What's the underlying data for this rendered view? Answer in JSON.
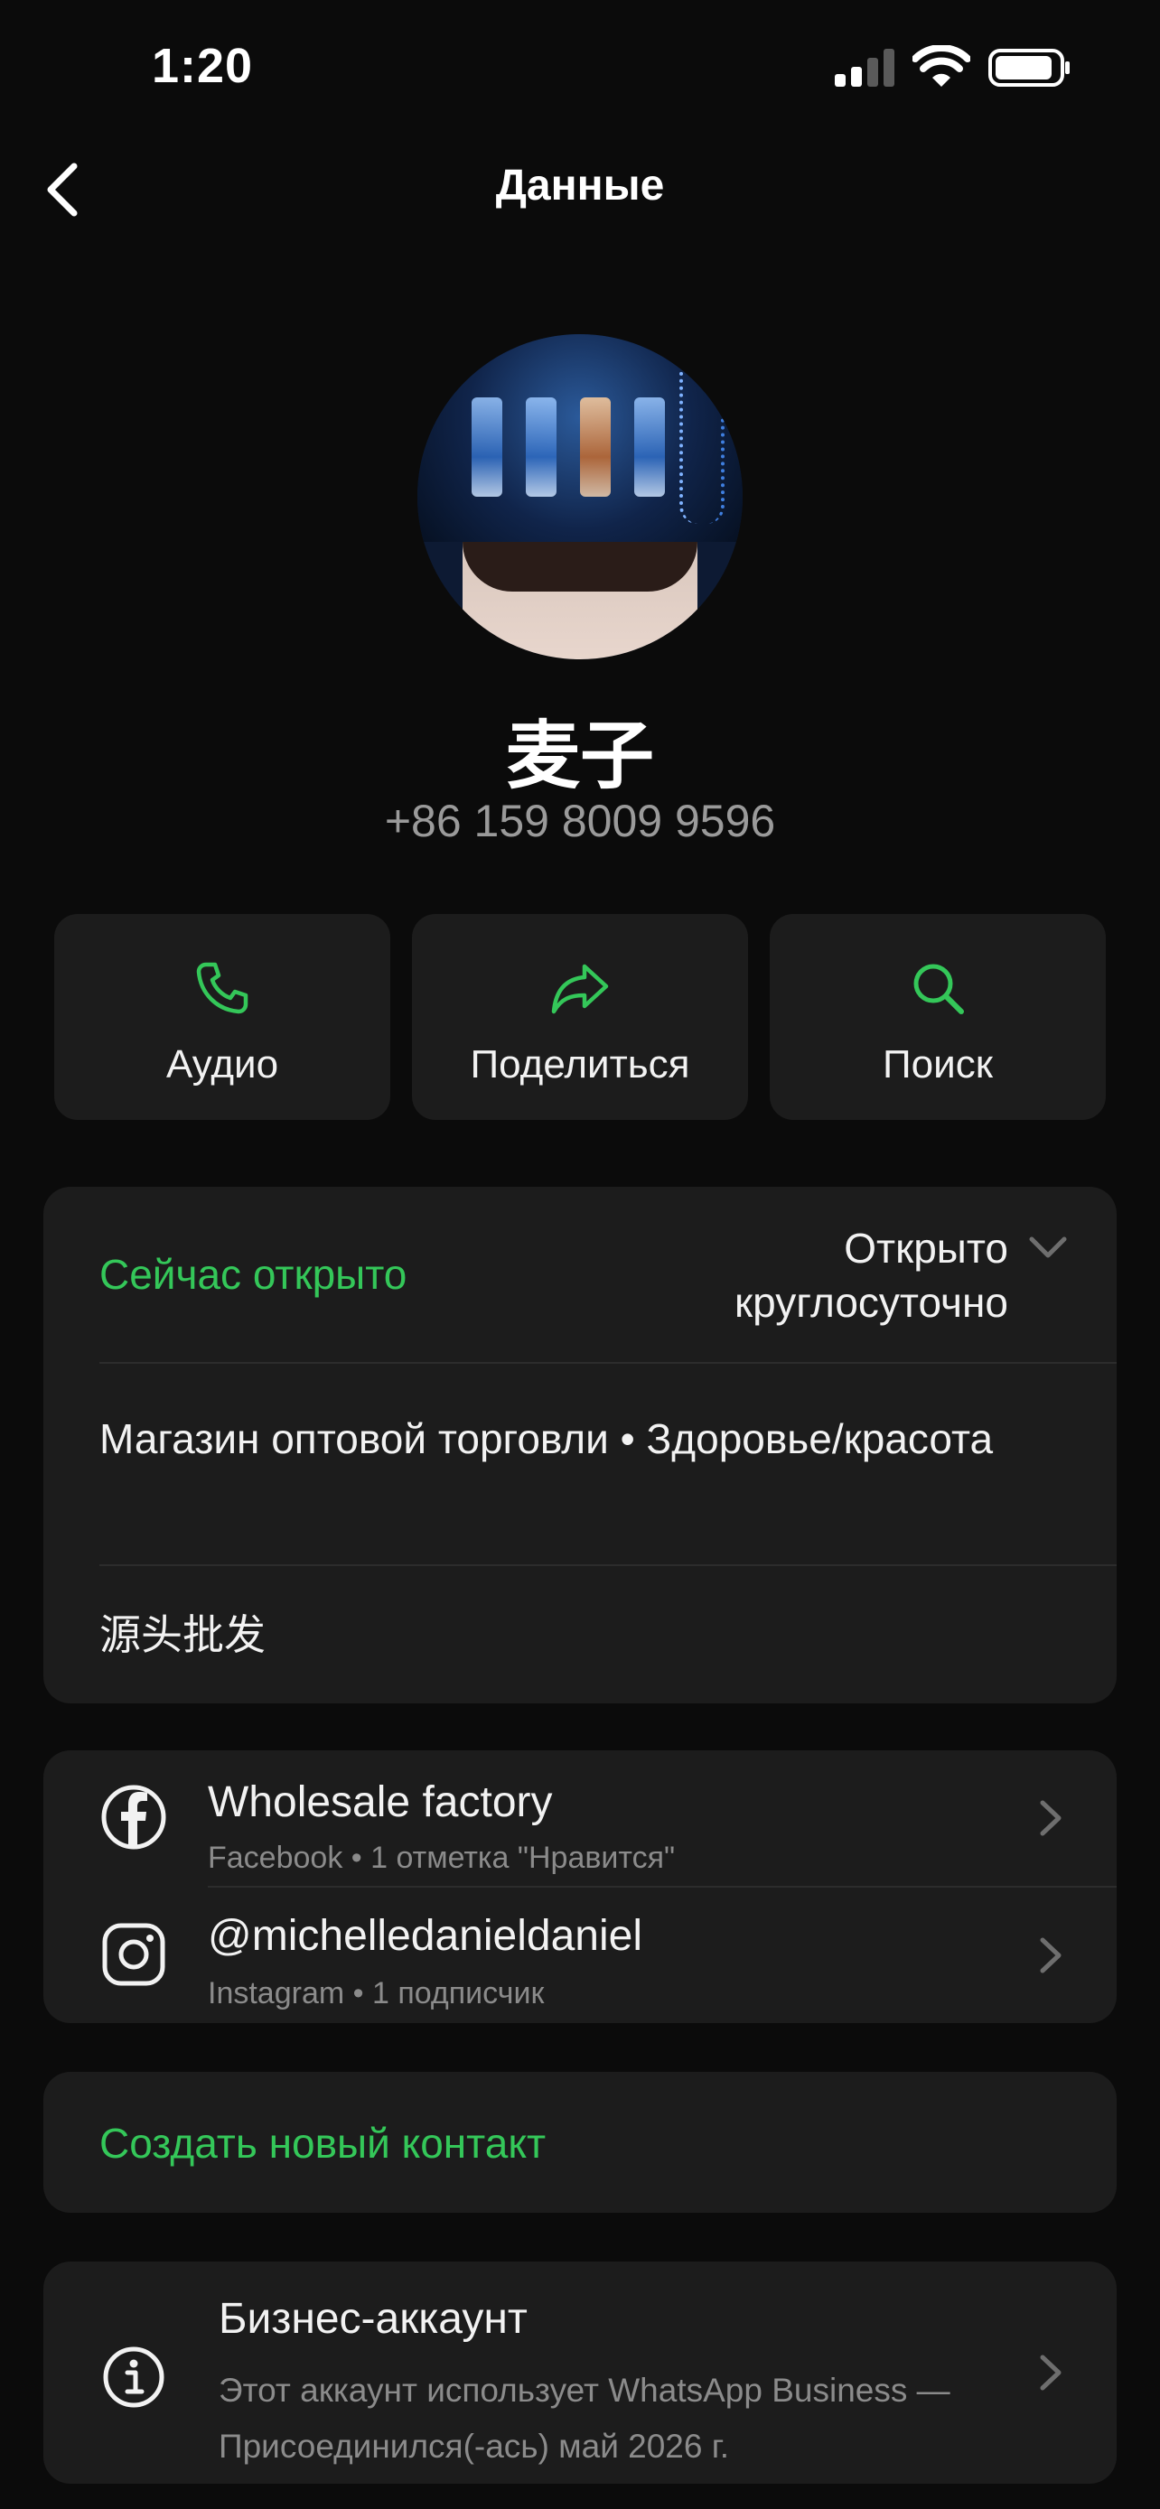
{
  "status_bar": {
    "time": "1:20"
  },
  "nav": {
    "title": "Данные"
  },
  "contact": {
    "name": "麦子",
    "phone": "+86 159 8009 9596"
  },
  "actions": [
    {
      "label": "Аудио",
      "icon": "phone-icon"
    },
    {
      "label": "Поделиться",
      "icon": "share-arrow-icon"
    },
    {
      "label": "Поиск",
      "icon": "search-icon"
    }
  ],
  "business_info": {
    "hours_status": "Сейчас открыто",
    "hours_value_line1": "Открыто",
    "hours_value_line2": "круглосуточно",
    "category": "Магазин оптовой торговли • Здоровье/красота",
    "description": "源头批发"
  },
  "social": [
    {
      "title": "Wholesale factory",
      "subtitle": "Facebook • 1 отметка \"Нравится\"",
      "icon": "facebook-icon"
    },
    {
      "title": "@michelledanieldaniel",
      "subtitle": "Instagram • 1 подписчик",
      "icon": "instagram-icon"
    }
  ],
  "create_contact": {
    "label": "Создать новый контакт"
  },
  "business_account": {
    "title": "Бизнес-аккаунт",
    "description": "Этот аккаунт использует WhatsApp Business — Присоединился(-ась) май 2026 г."
  },
  "colors": {
    "accent": "#34c759",
    "background": "#0b0b0b",
    "card": "#1c1c1c",
    "secondary_text": "#8b8b8b"
  }
}
